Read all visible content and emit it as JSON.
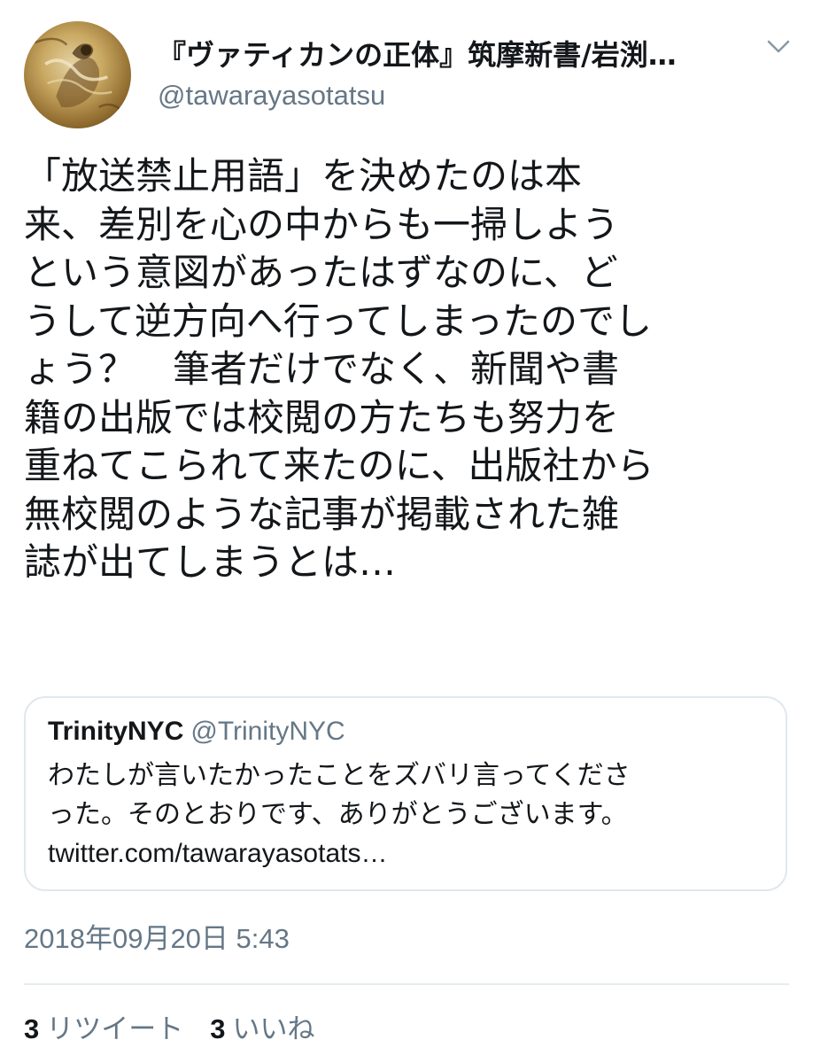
{
  "author": {
    "display_name": "『ヴァティカンの正体』筑摩新書/岩渕…",
    "handle": "@tawarayasotatsu",
    "avatar_icon": "avatar-painting-icon"
  },
  "menu": {
    "icon": "chevron-down-icon"
  },
  "tweet": {
    "lines": [
      "「放送禁止用語」を決めたのは本",
      "来、差別を心の中からも一掃しよう",
      "という意図があったはずなのに、ど",
      "うして逆方向へ行ってしまったのでし",
      "ょう？　筆者だけでなく、新聞や書",
      "籍の出版では校閲の方たちも努力を",
      "重ねてこられて来たのに、出版社から",
      "無校閲のような記事が掲載された雑",
      "誌が出てしまうとは…"
    ]
  },
  "quote": {
    "name": "TrinityNYC",
    "handle": "@TrinityNYC",
    "lines": [
      "わたしが言いたかったことをズバリ言ってくださ",
      "った。そのとおりです、ありがとうございます。"
    ],
    "link": "twitter.com/tawarayasotats…"
  },
  "timestamp": "2018年09月20日 5:43",
  "stats": {
    "retweets_count": "3",
    "retweets_label": "リツイート",
    "likes_count": "3",
    "likes_label": "いいね"
  },
  "colors": {
    "text": "#14171a",
    "secondary": "#657786",
    "border": "#e1e8ed"
  }
}
